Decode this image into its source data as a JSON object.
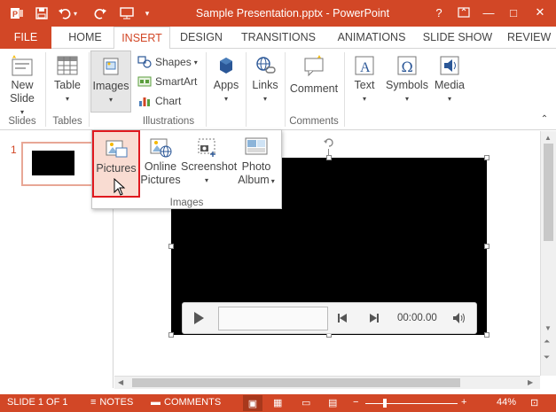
{
  "window": {
    "title": "Sample Presentation.pptx - PowerPoint",
    "help_label": "?",
    "min_label": "—",
    "max_label": "□",
    "close_label": "✕"
  },
  "tabs": [
    {
      "label": "FILE"
    },
    {
      "label": "HOME"
    },
    {
      "label": "INSERT"
    },
    {
      "label": "DESIGN"
    },
    {
      "label": "TRANSITIONS"
    },
    {
      "label": "ANIMATIONS"
    },
    {
      "label": "SLIDE SHOW"
    },
    {
      "label": "REVIEW"
    }
  ],
  "ribbon": {
    "new_slide": "New",
    "new_slide_2": "Slide",
    "table": "Table",
    "images": "Images",
    "shapes": "Shapes",
    "smartart": "SmartArt",
    "chart": "Chart",
    "apps": "Apps",
    "links": "Links",
    "comment": "Comment",
    "text": "Text",
    "symbols": "Symbols",
    "media": "Media",
    "groups": {
      "slides": "Slides",
      "tables": "Tables",
      "illustrations": "Illustrations",
      "comments": "Comments"
    }
  },
  "dropdown": {
    "pictures": "Pictures",
    "online": "Online",
    "online_2": "Pictures",
    "screenshot": "Screenshot",
    "photo": "Photo",
    "photo_2": "Album",
    "group": "Images"
  },
  "thumbnails": [
    {
      "number": "1"
    }
  ],
  "video": {
    "time": "00:00.00"
  },
  "status": {
    "slide_info": "SLIDE 1 OF 1",
    "notes": "NOTES",
    "comments": "COMMENTS",
    "zoom": "44%"
  },
  "colors": {
    "accent": "#d24726",
    "highlight_border": "#e0191f"
  }
}
